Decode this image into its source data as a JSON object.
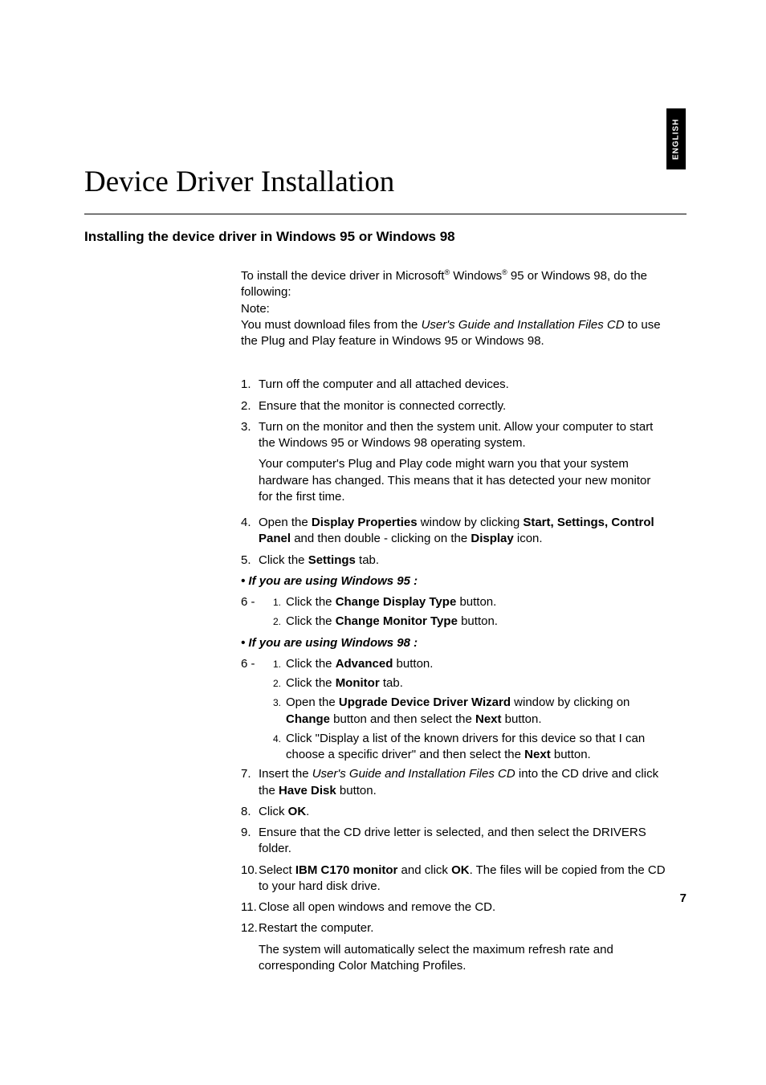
{
  "language_tab": "ENGLISH",
  "title": "Device Driver Installation",
  "section_title": "Installing the device driver in Windows 95 or Windows 98",
  "intro": {
    "line1a": "To install the device driver in Microsoft",
    "line1b": " Windows",
    "line1c": " 95 or Windows 98, do the following:",
    "note_label": "Note:",
    "note_a": "You must download files from the ",
    "note_cd": "User's Guide and Installation Files CD",
    "note_b": " to use the Plug and Play feature in Windows 95 or Windows 98."
  },
  "steps": {
    "s1": "Turn off the computer and all attached devices.",
    "s2": "Ensure that the monitor is connected correctly.",
    "s3a": "Turn on the monitor and then the system unit. Allow your computer to start the Windows 95 or Windows 98 operating system.",
    "s3b": "Your computer's Plug and Play code might warn you that your system hardware has changed. This means that it has detected your new monitor for the first time.",
    "s4_pre": "Open the ",
    "s4_dp": "Display Properties",
    "s4_mid": " window by clicking ",
    "s4_ssc": "Start, Settings, Control Panel",
    "s4_mid2": " and then double - clicking on the ",
    "s4_disp": "Display",
    "s4_end": " icon.",
    "s5_pre": "Click the ",
    "s5_set": "Settings",
    "s5_end": " tab.",
    "cond95": "• If you are using Windows 95 :",
    "w95_1_pre": "Click the ",
    "w95_1_b": "Change Display Type",
    "w95_1_end": " button.",
    "w95_2_pre": "Click the ",
    "w95_2_b": "Change Monitor Type",
    "w95_2_end": " button.",
    "cond98": "• If you are using Windows 98 :",
    "w98_1_pre": "Click the ",
    "w98_1_b": "Advanced",
    "w98_1_end": " button.",
    "w98_2_pre": "Click the ",
    "w98_2_b": "Monitor",
    "w98_2_end": " tab.",
    "w98_3_pre": "Open the ",
    "w98_3_b": "Upgrade Device Driver Wizard",
    "w98_3_mid": " window by clicking on ",
    "w98_3_b2": "Change",
    "w98_3_mid2": " button and then select the ",
    "w98_3_b3": "Next",
    "w98_3_end": " button.",
    "w98_4_pre": "Click \"Display a list of the known drivers for this device so that I can choose a specific driver\" and  then select the ",
    "w98_4_b": "Next",
    "w98_4_end": " button.",
    "s7_pre": "Insert the ",
    "s7_cd": "User's Guide and Installation Files CD",
    "s7_mid": " into the CD drive and click the ",
    "s7_b": "Have Disk",
    "s7_end": " button.",
    "s8_pre": "Click ",
    "s8_b": "OK",
    "s8_end": ".",
    "s9": "Ensure that the CD drive letter is selected, and then select the DRIVERS folder.",
    "s10_pre": "Select ",
    "s10_b": "IBM C170 monitor",
    "s10_mid": " and click ",
    "s10_b2": "OK",
    "s10_end": ". The files will be copied from the CD to your hard disk drive.",
    "s11": "Close all open windows and remove the CD.",
    "s12a": "Restart the computer.",
    "s12b": "The system will automatically select the maximum refresh rate and corresponding Color Matching Profiles."
  },
  "page_number": "7",
  "reg_mark": "®"
}
